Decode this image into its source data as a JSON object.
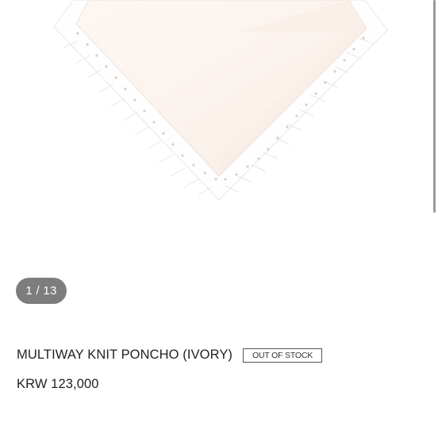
{
  "gallery": {
    "counter": "1 / 13"
  },
  "product": {
    "title": "MULTIWAY KNIT PONCHO (IVORY)",
    "stock_status": "OUT OF STOCK",
    "price": "KRW 123,000",
    "image_icon": "knit-poncho-photo"
  },
  "colors": {
    "background": "#ffffff",
    "counter_pill": "#7d7d7d",
    "text": "#222222",
    "fabric": "#fbf4ef",
    "fringe": "#ffffff"
  }
}
